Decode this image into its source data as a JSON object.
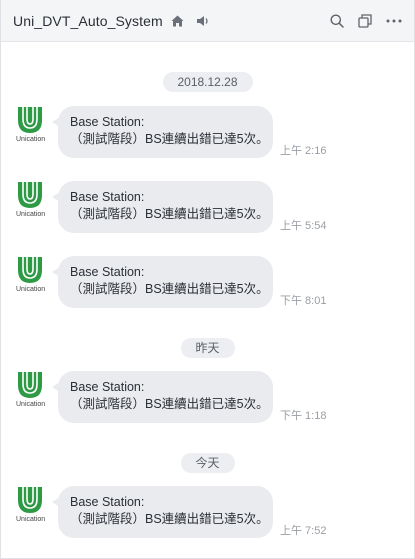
{
  "header": {
    "title": "Uni_DVT_Auto_System",
    "icons": [
      "home-icon",
      "speaker-icon",
      "search-icon",
      "copy-icon",
      "more-icon"
    ]
  },
  "avatar": {
    "text": "Unication",
    "colors": {
      "green": "#2e9a46",
      "white": "#ffffff"
    }
  },
  "dividers": {
    "d1": "2018.12.28",
    "d2": "昨天",
    "d3": "今天"
  },
  "messages": [
    {
      "line1": "Base Station:",
      "line2": "（測試階段）BS連續出錯已達5次。",
      "time": "上午 2:16"
    },
    {
      "line1": "Base Station:",
      "line2": "（測試階段）BS連續出錯已達5次。",
      "time": "上午 5:54"
    },
    {
      "line1": "Base Station:",
      "line2": "（測試階段）BS連續出錯已達5次。",
      "time": "下午 8:01"
    },
    {
      "line1": "Base Station:",
      "line2": "（測試階段）BS連續出錯已達5次。",
      "time": "下午 1:18"
    },
    {
      "line1": "Base Station:",
      "line2": "（測試階段）BS連續出錯已達5次。",
      "time": "上午 7:52"
    }
  ]
}
